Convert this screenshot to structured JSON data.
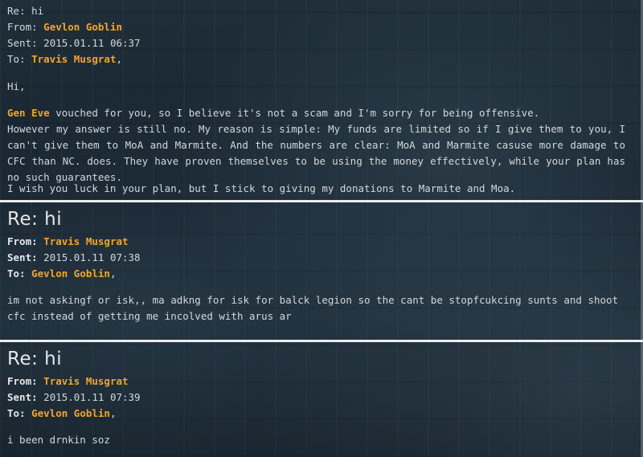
{
  "messages": [
    {
      "subject": "Re: hi",
      "from_label": "From:",
      "from": "Gevlon Goblin",
      "sent_label": "Sent:",
      "sent": "2015.01.11 06:37",
      "to_label": "To:",
      "to": "Travis Musgrat",
      "to_suffix": ",",
      "greeting": "Hi,",
      "body_name": "Gen Eve",
      "body_line1": " vouched for you, so I believe it's not a scam and I'm sorry for being offensive.",
      "body_para2": "However my answer is still no. My reason is simple: My funds are limited so if I give them to you, I can't give them to MoA and Marmite. And the numbers are clear: MoA and Marmite casuse more damage to CFC than NC. does. They have proven themselves to be using the money effectively, while your plan has no such guarantees.",
      "body_para3": "I wish you luck in your plan, but I stick to giving my donations to Marmite and Moa."
    },
    {
      "subject": "Re: hi",
      "from_label": "From:",
      "from": "Travis Musgrat",
      "sent_label": "Sent:",
      "sent": "2015.01.11 07:38",
      "to_label": "To:",
      "to": "Gevlon Goblin",
      "to_suffix": ",",
      "body": "im not askingf or isk,, ma adkng for isk for balck legion so the cant be stopfcukcing sunts and shoot cfc instead of getting me incolved with arus ar"
    },
    {
      "subject": "Re: hi",
      "from_label": "From:",
      "from": "Travis Musgrat",
      "sent_label": "Sent:",
      "sent": "2015.01.11 07:39",
      "to_label": "To:",
      "to": "Gevlon Goblin",
      "to_suffix": ",",
      "body": "i been drnkin soz"
    }
  ],
  "colors": {
    "name_accent": "#f2a52c",
    "text": "#d2d8dd",
    "divider": "#e9eef1"
  }
}
